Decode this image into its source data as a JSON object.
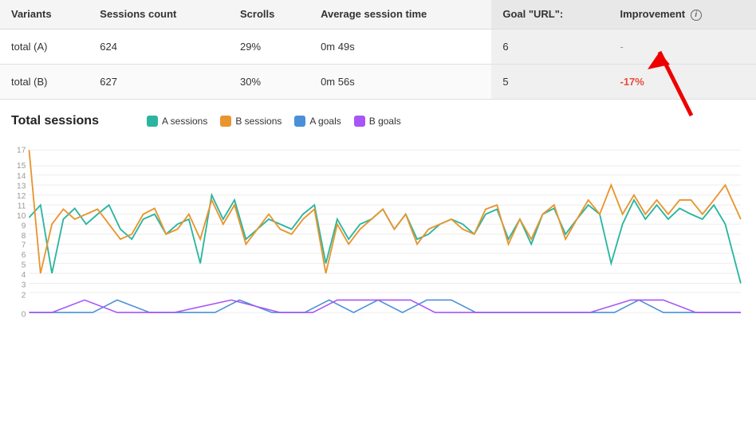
{
  "table": {
    "headers": [
      "Variants",
      "Sessions count",
      "Scrolls",
      "Average session time",
      "Goal \"URL\":",
      "Improvement"
    ],
    "rows": [
      {
        "variant": "total (A)",
        "sessions": "624",
        "scrolls": "29%",
        "avg_session": "0m 49s",
        "goal": "6",
        "improvement": "-",
        "improvement_type": "dash"
      },
      {
        "variant": "total (B)",
        "sessions": "627",
        "scrolls": "30%",
        "avg_session": "0m 56s",
        "goal": "5",
        "improvement": "-17%",
        "improvement_type": "negative"
      }
    ]
  },
  "chart": {
    "title": "Total sessions",
    "legend": [
      {
        "label": "A sessions",
        "color": "#2bb5a0",
        "type": "line"
      },
      {
        "label": "B sessions",
        "color": "#e8952e",
        "type": "line"
      },
      {
        "label": "A goals",
        "color": "#4a90d9",
        "type": "line"
      },
      {
        "label": "B goals",
        "color": "#a855f7",
        "type": "line"
      }
    ],
    "y_labels": [
      "0",
      "2",
      "3",
      "4",
      "5",
      "6",
      "7",
      "8",
      "9",
      "10",
      "11",
      "12",
      "13",
      "14",
      "15",
      "17"
    ],
    "info_label": "i"
  }
}
